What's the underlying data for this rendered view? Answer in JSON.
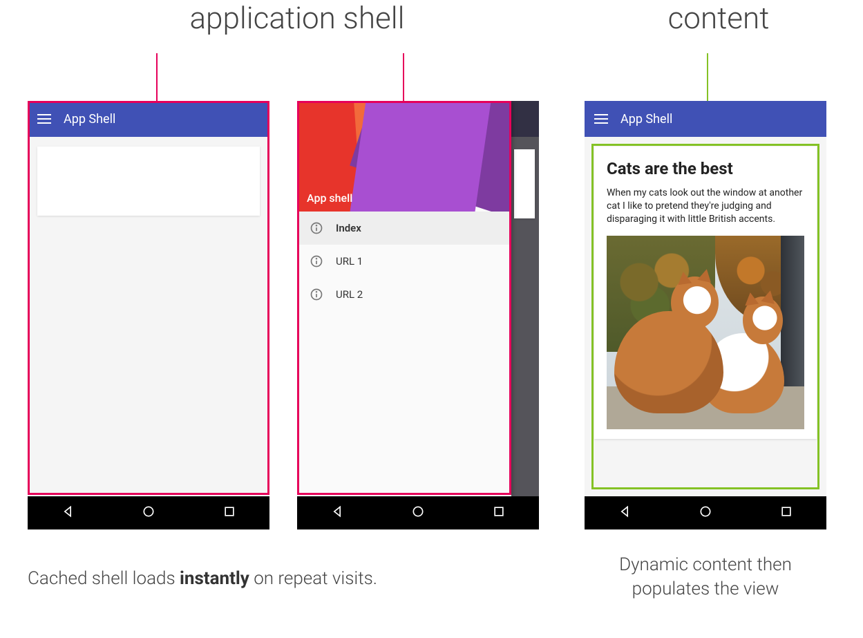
{
  "labels": {
    "app_shell": "application shell",
    "content": "content"
  },
  "captions": {
    "left_pre": "Cached shell loads ",
    "left_strong": "instantly",
    "left_post": " on repeat visits.",
    "right": "Dynamic content then populates the view"
  },
  "appbar": {
    "title": "App Shell"
  },
  "drawer": {
    "header_title": "App shell",
    "items": [
      {
        "label": "Index",
        "selected": true
      },
      {
        "label": "URL 1",
        "selected": false
      },
      {
        "label": "URL 2",
        "selected": false
      }
    ]
  },
  "content": {
    "title": "Cats are the best",
    "body": "When my cats look out the window at another cat I like to pretend they're judging and disparaging it with little British accents.",
    "image_alt": "two orange-and-white cats looking out a window at autumn trees"
  },
  "colors": {
    "pink": "#e6005a",
    "green": "#84c225",
    "indigo": "#4051b5"
  }
}
